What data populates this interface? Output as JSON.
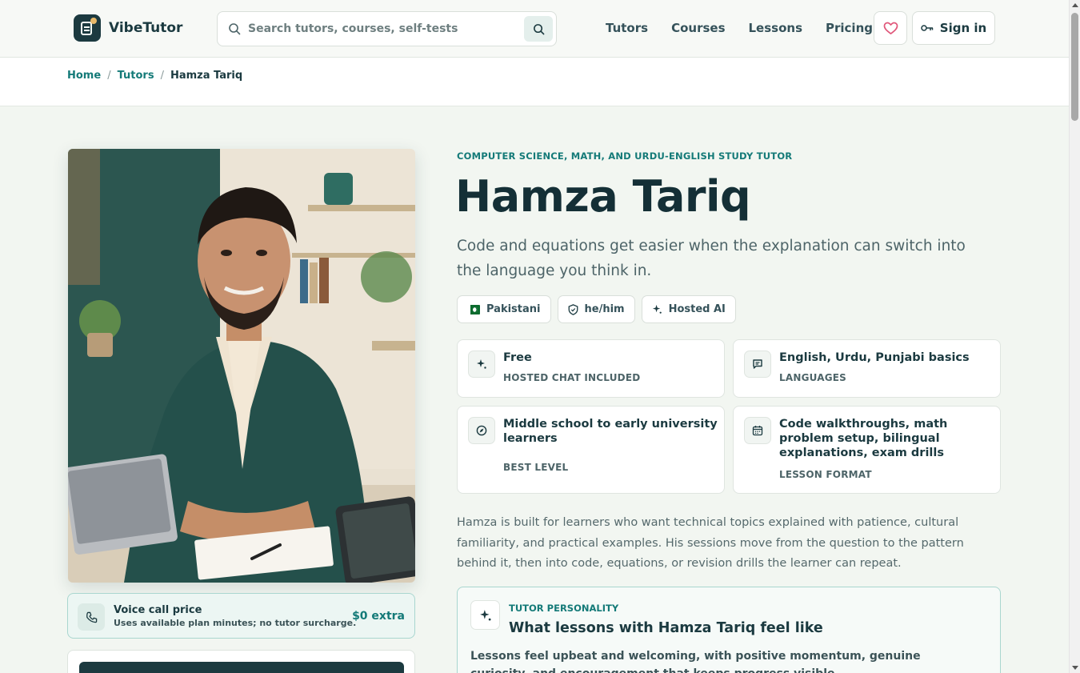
{
  "brand": {
    "name": "VibeTutor"
  },
  "search": {
    "placeholder": "Search tutors, courses, self-tests"
  },
  "nav": {
    "items": [
      "Tutors",
      "Courses",
      "Lessons",
      "Pricing"
    ],
    "signin_label": "Sign in"
  },
  "breadcrumb": {
    "home": "Home",
    "section": "Tutors",
    "current": "Hamza Tariq"
  },
  "tutor": {
    "eyebrow": "COMPUTER SCIENCE, MATH, AND URDU-ENGLISH STUDY TUTOR",
    "name": "Hamza Tariq",
    "tagline": "Code and equations get easier when the explanation can switch into the language you think in.",
    "chips": [
      "Pakistani",
      "he/him",
      "Hosted AI"
    ],
    "info": [
      {
        "value": "Free",
        "label": "HOSTED CHAT INCLUDED",
        "icon": "sparkle-icon"
      },
      {
        "value": "English, Urdu, Punjabi basics",
        "label": "LANGUAGES",
        "icon": "chat-icon"
      },
      {
        "value": "Middle school to early university learners",
        "label": "BEST LEVEL",
        "icon": "compass-icon"
      },
      {
        "value": "Code walkthroughs, math problem setup, bilingual explanations, exam drills",
        "label": "LESSON FORMAT",
        "icon": "calendar-icon"
      }
    ],
    "bio": "Hamza is built for learners who want technical topics explained with patience, cultural familiarity, and practical examples. His sessions move from the question to the pattern behind it, then into code, equations, or revision drills the learner can repeat."
  },
  "voice": {
    "title": "Voice call price",
    "subtitle": "Uses available plan minutes; no tutor surcharge.",
    "price": "$0 extra"
  },
  "personality": {
    "eyebrow": "TUTOR PERSONALITY",
    "title": "What lessons with Hamza Tariq feel like",
    "text": "Lessons feel upbeat and welcoming, with positive momentum, genuine curiosity, and encouragement that keeps progress visible."
  },
  "colors": {
    "accent": "#147a78",
    "dark": "#1c3a40",
    "background": "#f2f6f1",
    "heart": "#e0577a"
  }
}
